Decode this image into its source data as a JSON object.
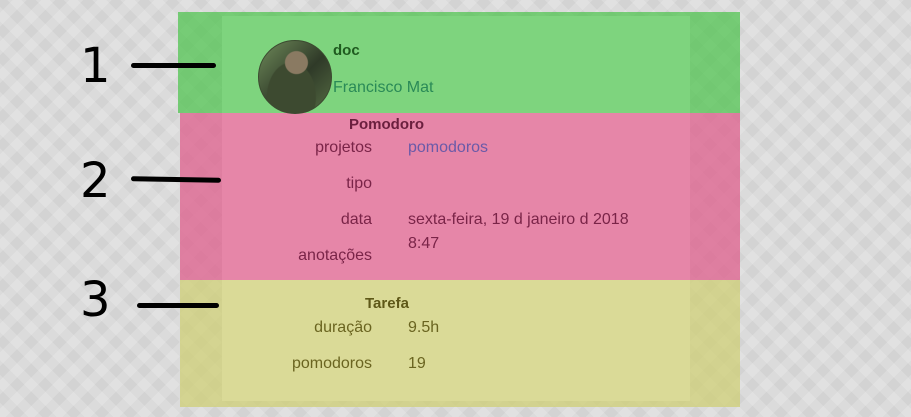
{
  "callouts": [
    "1",
    "2",
    "3"
  ],
  "header": {
    "title": "doc",
    "user": "Francisco Mat"
  },
  "pomodoro": {
    "title": "Pomodoro",
    "projetos_label": "projetos",
    "projetos_value": "pomodoros",
    "tipo_label": "tipo",
    "data_label": "data",
    "data_value": "sexta-feira, 19 d janeiro d 2018",
    "time_value": "8:47",
    "anotacoes_label": "anotações"
  },
  "tarefa": {
    "title": "Tarefa",
    "duracao_label": "duração",
    "duracao_value": "9.5h",
    "pomodoros_label": "pomodoros",
    "pomodoros_value": "19"
  },
  "colors": {
    "section1": "#4cc44c",
    "section2": "#de608c",
    "section3": "#d0d07a"
  }
}
